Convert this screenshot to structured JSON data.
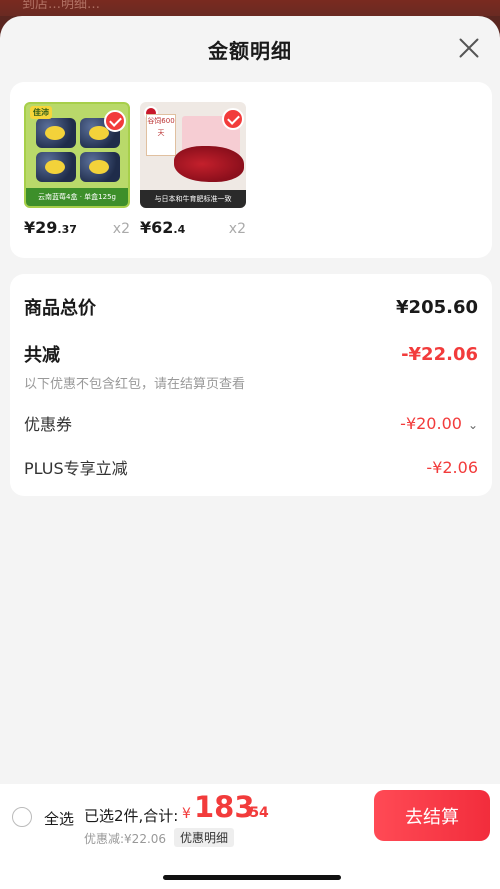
{
  "background_hint": "到店…明细…",
  "sheet": {
    "title": "金额明细",
    "close_icon": "close-icon"
  },
  "products": [
    {
      "name": "blueberry",
      "image_label": "云南蓝莓4盒 · 单盒125g",
      "brand": "佳沛",
      "price_int": "¥29",
      "price_dec": ".37",
      "qty": "x2",
      "checked": true
    },
    {
      "name": "beef",
      "image_label": "与日本和牛育肥标准一致",
      "tag": "谷饲600天",
      "price_int": "¥62",
      "price_dec": ".4",
      "qty": "x2",
      "checked": true
    }
  ],
  "summary": {
    "total_label": "商品总价",
    "total_value": "¥205.60",
    "reduce_label": "共减",
    "reduce_value": "-¥22.06",
    "note": "以下优惠不包含红包，请在结算页查看",
    "coupon_label": "优惠券",
    "coupon_value": "-¥20.00",
    "plus_label": "PLUS专享立减",
    "plus_value": "-¥2.06"
  },
  "bottom": {
    "select_all": "全选",
    "selected": "已选2件,合计:",
    "currency": "¥",
    "total_int": "183",
    "total_dec": ".54",
    "discount": "优惠减:¥22.06",
    "detail_tag": "优惠明细",
    "checkout": "去结算"
  },
  "colors": {
    "accent_red": "#f23b3b",
    "overlay": "#5a2620"
  }
}
